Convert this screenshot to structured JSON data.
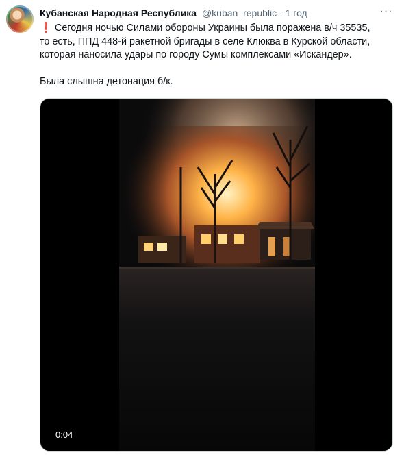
{
  "author": {
    "name": "Кубанская Народная Республика",
    "handle": "@kuban_republic",
    "separator": "·",
    "time": "1 год"
  },
  "more_label": "···",
  "tweet": {
    "emoji": "❗",
    "line1": " Сегодня ночью Силами обороны Украины была поражена в/ч 35535,",
    "line2": "то есть, ППД 448-й ракетной бригады в селе Клюква в Курской области,",
    "line3": "которая наносила удары по городу Сумы комплексами «Искандер».",
    "line4": "Была слышна детонация б/к."
  },
  "video": {
    "duration": "0:04"
  },
  "colors": {
    "text": "#0f1419",
    "secondary": "#536471",
    "exclamation": "#d0021b",
    "media_bg": "#000000"
  }
}
